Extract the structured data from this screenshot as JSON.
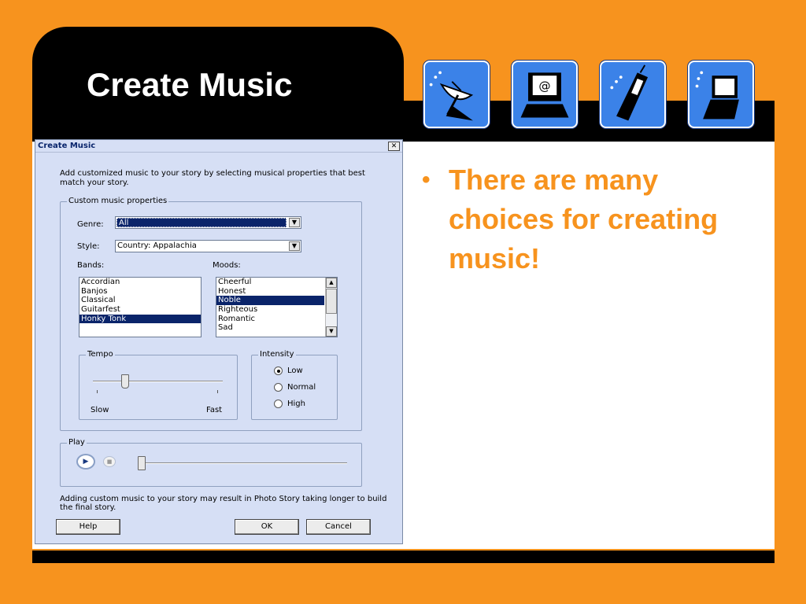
{
  "slide": {
    "title": "Create Music",
    "bullet": "There are many choices for creating music!"
  },
  "icons": [
    "satellite-dish-icon",
    "email-computer-icon",
    "mobile-phone-icon",
    "handheld-device-icon"
  ],
  "colors": {
    "background": "#f7931e",
    "bullet_text": "#f7931e",
    "icon_tile": "#3b82e8",
    "selection": "#0a246a"
  },
  "dialog": {
    "title": "Create Music",
    "close_label": "✕",
    "intro": "Add customized music to your story by selecting musical properties that best match your story.",
    "custom_group_label": "Custom music properties",
    "genre": {
      "label": "Genre:",
      "value": "All"
    },
    "style": {
      "label": "Style:",
      "value": "Country: Appalachia"
    },
    "bands": {
      "label": "Bands:",
      "items": [
        "Accordian",
        "Banjos",
        "Classical",
        "Guitarfest",
        "Honky Tonk"
      ],
      "selected": "Honky Tonk"
    },
    "moods": {
      "label": "Moods:",
      "items": [
        "Cheerful",
        "Honest",
        "Noble",
        "Righteous",
        "Romantic",
        "Sad"
      ],
      "selected": "Noble"
    },
    "tempo": {
      "label": "Tempo",
      "slow_label": "Slow",
      "fast_label": "Fast",
      "value_fraction": 0.25
    },
    "intensity": {
      "label": "Intensity",
      "options": [
        "Low",
        "Normal",
        "High"
      ],
      "selected": "Low"
    },
    "play": {
      "label": "Play",
      "position_fraction": 0.0
    },
    "note": "Adding custom music to your story may result in Photo Story taking longer to build the final story.",
    "buttons": {
      "help": "Help",
      "ok": "OK",
      "cancel": "Cancel"
    }
  }
}
